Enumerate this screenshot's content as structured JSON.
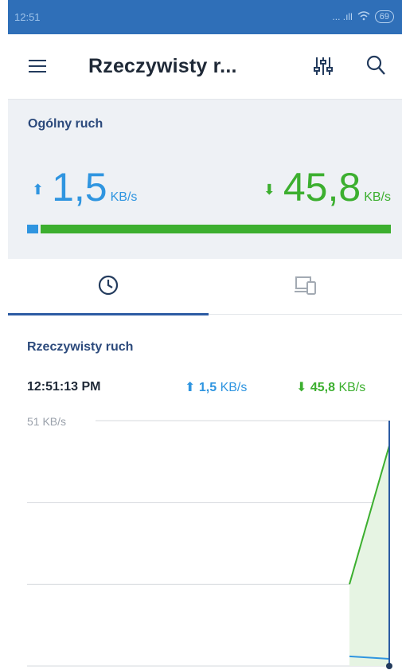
{
  "status_bar": {
    "time": "12:51",
    "signal": "... .ıll",
    "battery": "69"
  },
  "app_bar": {
    "title": "Rzeczywisty r..."
  },
  "overview": {
    "heading": "Ogólny ruch",
    "upload_value": "1,5",
    "upload_unit": "KB/s",
    "download_value": "45,8",
    "download_unit": "KB/s",
    "upload_share": 0.03
  },
  "tabs": [
    {
      "name": "history",
      "icon": "clock-icon",
      "active": true
    },
    {
      "name": "devices",
      "icon": "devices-icon",
      "active": false
    }
  ],
  "realtime": {
    "heading": "Rzeczywisty ruch",
    "time": "12:51:13 PM",
    "upload_value": "1,5",
    "upload_unit": "KB/s",
    "download_value": "45,8",
    "download_unit": "KB/s"
  },
  "chart_data": {
    "type": "area",
    "max_label": "51 KB/s",
    "ylim": [
      0,
      51
    ],
    "series": [
      {
        "values": [
          17,
          45.8
        ],
        "color": "#3caf2f"
      },
      {
        "values": [
          2,
          1.5
        ],
        "color": "#2f95e0"
      }
    ],
    "grid": true
  },
  "colors": {
    "accent": "#2c5ba3",
    "upload": "#2f95e0",
    "download": "#3caf2f"
  }
}
